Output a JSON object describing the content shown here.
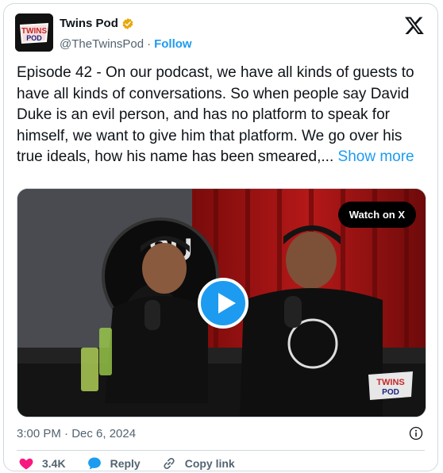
{
  "author": {
    "display_name": "Twins Pod",
    "handle": "@TheTwinsPod",
    "separator": "·",
    "follow_label": "Follow",
    "avatar_text_1": "TWINS",
    "avatar_text_2": "POD"
  },
  "tweet": {
    "text": "Episode 42 - On our podcast, we have all kinds of guests to have all kinds of conversations. So when people say David Duke is an evil person, and has no platform to speak for himself, we want to give him that platform. We go over his true ideals, how his name has been smeared,...",
    "show_more_label": "Show more"
  },
  "media": {
    "watch_label": "Watch on X",
    "watermark_1": "TWINS",
    "watermark_2": "POD"
  },
  "meta": {
    "timestamp": "3:00 PM · Dec 6, 2024"
  },
  "actions": {
    "likes": "3.4K",
    "reply_label": "Reply",
    "copy_label": "Copy link"
  },
  "colors": {
    "accent": "#1d9bf0",
    "like": "#f91880",
    "verified": "#e8a80a"
  },
  "icons": [
    "verified-badge-icon",
    "x-logo-icon",
    "play-icon",
    "info-icon",
    "heart-icon",
    "reply-icon",
    "link-icon"
  ]
}
